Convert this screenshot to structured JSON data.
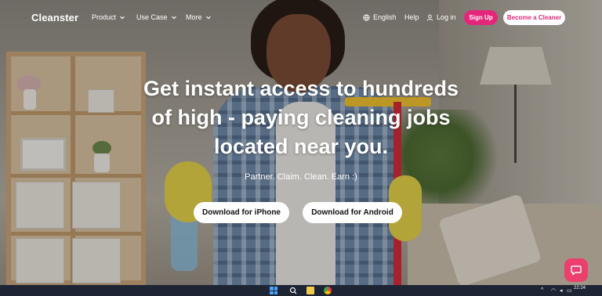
{
  "nav": {
    "logo": "Cleanster",
    "menus": [
      {
        "label": "Product"
      },
      {
        "label": "Use Case"
      },
      {
        "label": "More"
      }
    ],
    "language": "English",
    "help": "Help",
    "login": "Log in",
    "signup": "Sign Up",
    "become_cleaner": "Become a Cleaner"
  },
  "hero": {
    "headline_lines": [
      "Get instant access to hundreds",
      "of high - paying cleaning jobs",
      "located near you."
    ],
    "tagline": "Partner. Claim. Clean. Earn :)",
    "download_iphone": "Download for iPhone",
    "download_android": "Download for Android"
  },
  "taskbar": {
    "time": "22:24",
    "date": ""
  },
  "colors": {
    "accent": "#e4267b",
    "chat": "#ec3f6e"
  },
  "icons": {
    "language": "globe-icon",
    "login": "user-icon",
    "menu_chevron": "chevron-down-icon",
    "chat": "chat-bubble-icon"
  }
}
